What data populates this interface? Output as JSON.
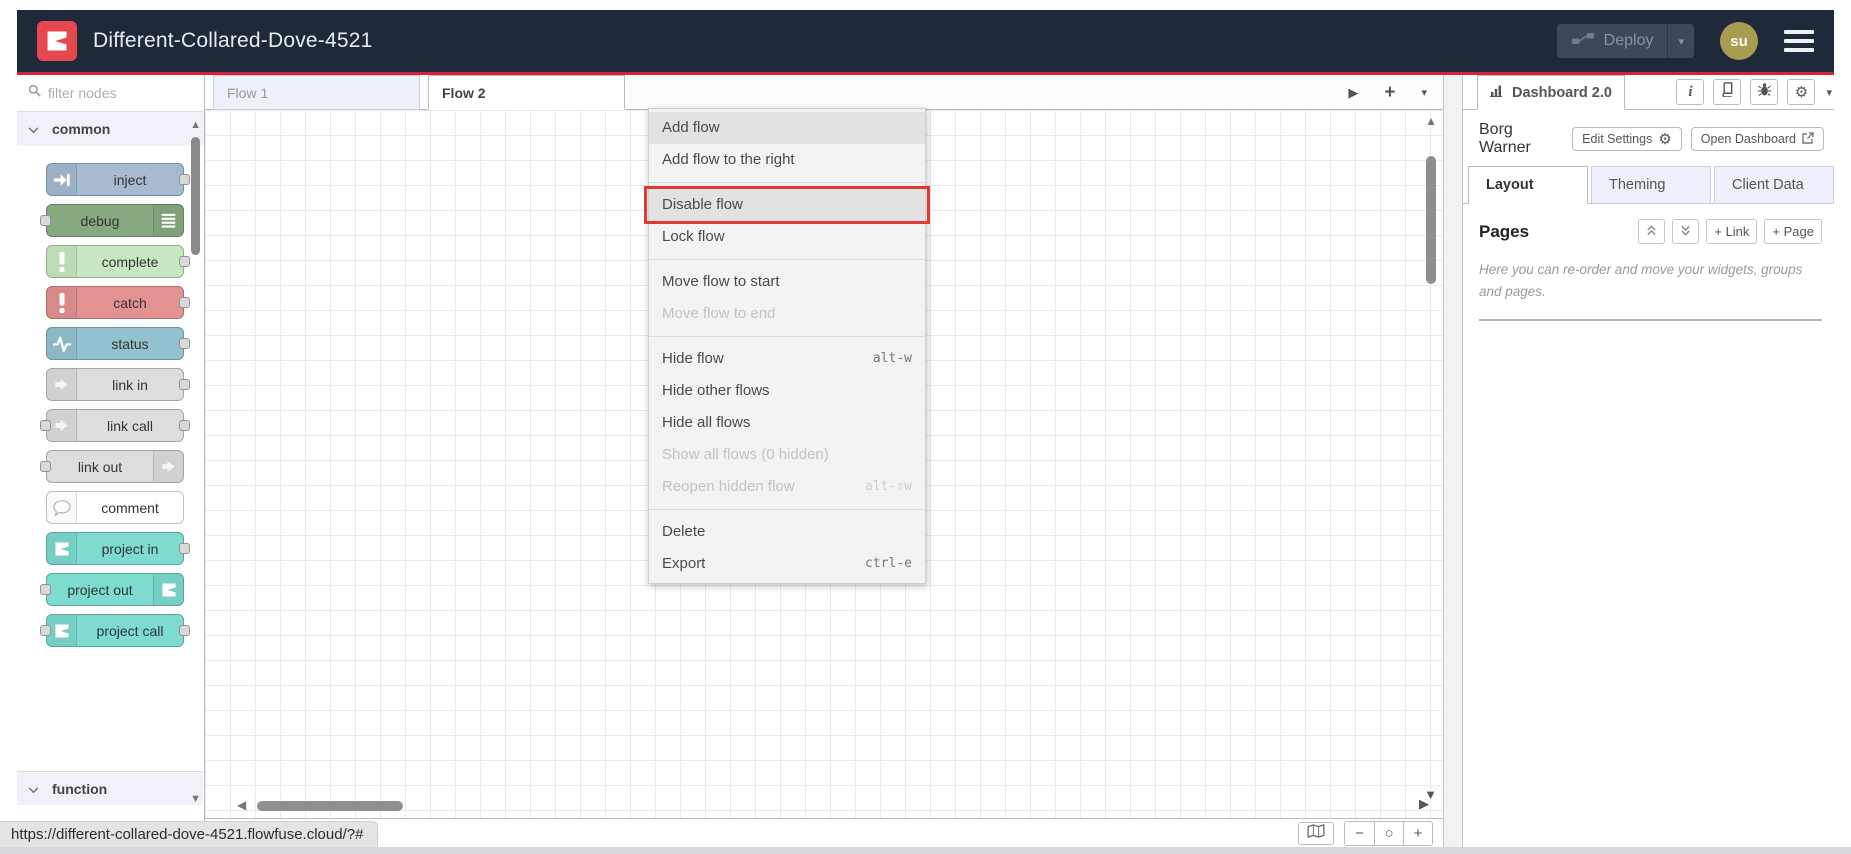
{
  "header": {
    "title": "Different-Collared-Dove-4521",
    "deploy_label": "Deploy",
    "avatar_initials": "su"
  },
  "palette": {
    "search_placeholder": "filter nodes",
    "categories": [
      {
        "label": "common"
      },
      {
        "label": "function"
      }
    ],
    "nodes": [
      {
        "label": "inject",
        "color": "#a6bbcf",
        "icon": "inject-icon",
        "icon_side": "left",
        "ports": [
          "out"
        ]
      },
      {
        "label": "debug",
        "color": "#87a980",
        "icon": "list-icon",
        "icon_side": "right",
        "ports": [
          "in"
        ]
      },
      {
        "label": "complete",
        "color": "#c7e8c0",
        "icon": "exclamation-icon",
        "icon_side": "left",
        "ports": [
          "out"
        ]
      },
      {
        "label": "catch",
        "color": "#e49191",
        "icon": "exclamation-icon",
        "icon_side": "left",
        "ports": [
          "out"
        ]
      },
      {
        "label": "status",
        "color": "#94c1d0",
        "icon": "pulse-icon",
        "icon_side": "left",
        "ports": [
          "out"
        ]
      },
      {
        "label": "link in",
        "color": "#dddddd",
        "icon": "link-icon",
        "icon_side": "left",
        "ports": [
          "out"
        ]
      },
      {
        "label": "link call",
        "color": "#dddddd",
        "icon": "link-icon",
        "icon_side": "left",
        "ports": [
          "in",
          "out"
        ]
      },
      {
        "label": "link out",
        "color": "#dddddd",
        "icon": "link-icon",
        "icon_side": "right",
        "ports": [
          "in"
        ]
      },
      {
        "label": "comment",
        "color": "#ffffff",
        "icon": "comment-icon",
        "icon_side": "left",
        "ports": []
      },
      {
        "label": "project in",
        "color": "#7ddbd0",
        "icon": "flowfuse-icon",
        "icon_side": "left",
        "ports": [
          "out"
        ]
      },
      {
        "label": "project out",
        "color": "#7ddbd0",
        "icon": "flowfuse-icon",
        "icon_side": "right",
        "ports": [
          "in"
        ]
      },
      {
        "label": "project call",
        "color": "#7ddbd0",
        "icon": "flowfuse-icon",
        "icon_side": "left",
        "ports": [
          "in",
          "out"
        ]
      }
    ]
  },
  "workspace": {
    "tabs": [
      {
        "label": "Flow 1",
        "active": false
      },
      {
        "label": "Flow 2",
        "active": true
      }
    ]
  },
  "context_menu": {
    "items": [
      {
        "label": "Add flow",
        "state": "hover"
      },
      {
        "label": "Add flow to the right"
      },
      {
        "divider": true
      },
      {
        "label": "Disable flow",
        "state": "hover",
        "target": true
      },
      {
        "label": "Lock flow"
      },
      {
        "divider": true
      },
      {
        "label": "Move flow to start"
      },
      {
        "label": "Move flow to end",
        "disabled": true
      },
      {
        "divider": true
      },
      {
        "label": "Hide flow",
        "shortcut": "alt-w"
      },
      {
        "label": "Hide other flows"
      },
      {
        "label": "Hide all flows"
      },
      {
        "label": "Show all flows (0 hidden)",
        "disabled": true
      },
      {
        "label": "Reopen hidden flow",
        "shortcut": "alt-⇧w",
        "disabled": true
      },
      {
        "divider": true
      },
      {
        "label": "Delete"
      },
      {
        "label": "Export",
        "shortcut": "ctrl-e"
      }
    ]
  },
  "sidebar": {
    "tab_label": "Dashboard 2.0",
    "project_name": "Borg Warner",
    "edit_settings_label": "Edit Settings",
    "open_dashboard_label": "Open Dashboard",
    "tabs": [
      {
        "label": "Layout",
        "active": true
      },
      {
        "label": "Theming",
        "active": false
      },
      {
        "label": "Client Data",
        "active": false
      }
    ],
    "pages_title": "Pages",
    "add_link_label": "+ Link",
    "add_page_label": "+ Page",
    "helper_text": "Here you can re-order and move your widgets, groups and pages."
  },
  "statusbar": {
    "url": "https://different-collared-dove-4521.flowfuse.cloud/?#"
  },
  "icons": {
    "play": "▶",
    "add": "+",
    "caret_down": "▾",
    "scroll_up": "▲",
    "scroll_down": "▼",
    "scroll_left": "◀",
    "scroll_right": "▶",
    "zoom_out": "−",
    "zoom_reset": "○",
    "zoom_in": "+",
    "gear": "⚙",
    "external_arrow": "↗",
    "info": "i"
  },
  "colors": {
    "header_bg": "#1e2a3a",
    "accent_red_line": "#d6213a",
    "logo_red": "#e5484f",
    "avatar_bg": "#a89c4e",
    "target_ring": "#dd3a30",
    "grid_line": "#e9e9f4",
    "menu_bg": "#f3f3f3",
    "menu_hover": "#e2e2e2",
    "inactive_tab_bg": "#edeffa"
  }
}
